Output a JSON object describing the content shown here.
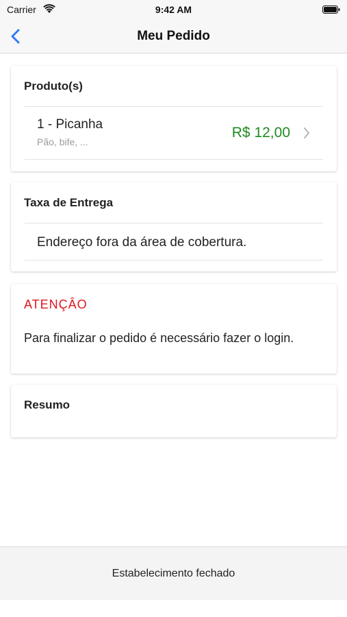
{
  "status_bar": {
    "carrier": "Carrier",
    "time": "9:42 AM"
  },
  "nav": {
    "title": "Meu Pedido",
    "back_icon": "chevron-left-icon",
    "accent_color": "#2f7bf5"
  },
  "products": {
    "title": "Produto(s)",
    "items": [
      {
        "name": "1 - Picanha",
        "description": "Pão, bife, ...",
        "price": "R$ 12,00"
      }
    ],
    "price_color": "#1f8a1f"
  },
  "delivery": {
    "title": "Taxa de Entrega",
    "message": "Endereço fora da área de cobertura."
  },
  "attention": {
    "title": "ATENÇÂO",
    "message": "Para finalizar o pedido é necessário fazer o login.",
    "color": "#e0141e"
  },
  "summary": {
    "title": "Resumo"
  },
  "footer": {
    "status": "Estabelecimento fechado"
  }
}
